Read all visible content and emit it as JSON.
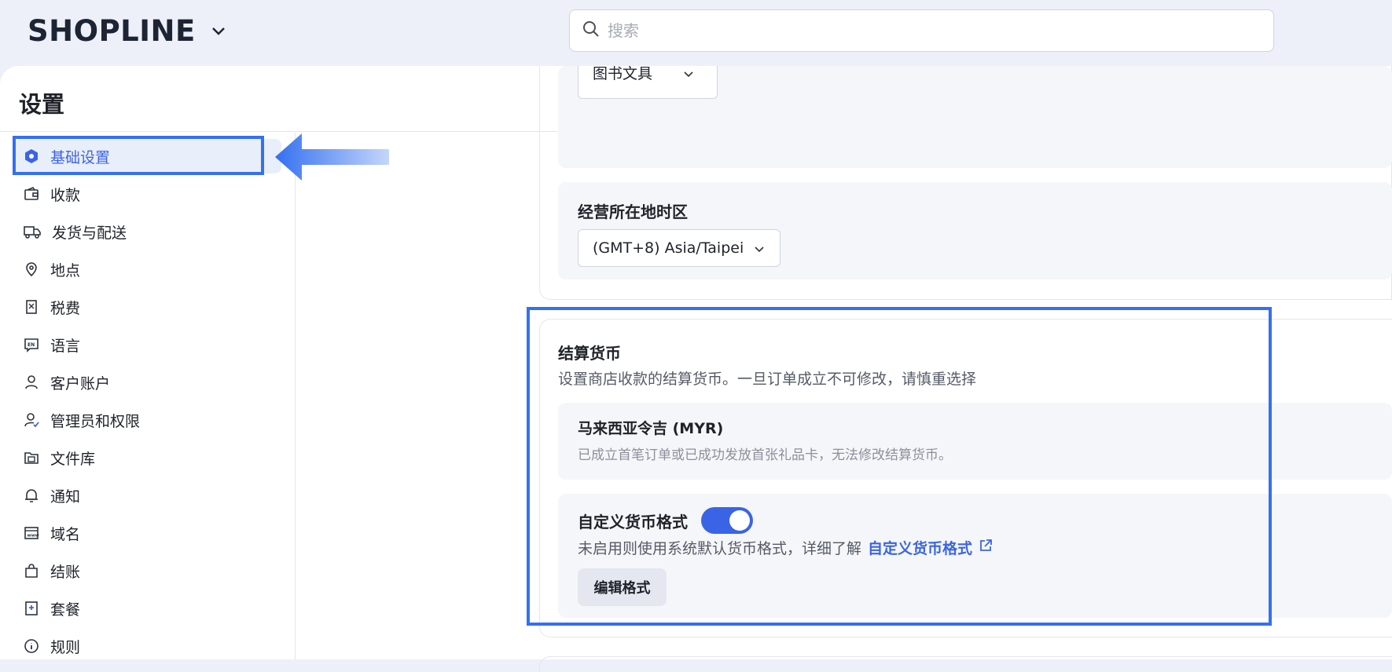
{
  "app": {
    "logo_text": "SHOPLINE"
  },
  "search": {
    "placeholder": "搜索"
  },
  "page": {
    "title": "设置"
  },
  "sidebar": {
    "items": [
      {
        "label": "基础设置",
        "icon": "hexagon-icon",
        "active": true
      },
      {
        "label": "收款",
        "icon": "wallet-icon"
      },
      {
        "label": "发货与配送",
        "icon": "truck-icon"
      },
      {
        "label": "地点",
        "icon": "location-pin-icon"
      },
      {
        "label": "税费",
        "icon": "receipt-icon"
      },
      {
        "label": "语言",
        "icon": "language-icon"
      },
      {
        "label": "客户账户",
        "icon": "user-icon"
      },
      {
        "label": "管理员和权限",
        "icon": "admin-icon"
      },
      {
        "label": "文件库",
        "icon": "folder-icon"
      },
      {
        "label": "通知",
        "icon": "bell-icon"
      },
      {
        "label": "域名",
        "icon": "domain-icon"
      },
      {
        "label": "结账",
        "icon": "shopping-bag-icon"
      },
      {
        "label": "套餐",
        "icon": "plan-icon"
      },
      {
        "label": "规则",
        "icon": "info-icon"
      }
    ]
  },
  "store": {
    "category_select": "图书文具",
    "timezone_label": "经营所在地时区",
    "timezone_value": "(GMT+8) Asia/Taipei"
  },
  "currency": {
    "title": "结算货币",
    "description": "设置商店收款的结算货币。一旦订单成立不可修改，请慎重选择",
    "selected_name": "马来西亚令吉 (MYR)",
    "selected_note": "已成立首笔订单或已成功发放首张礼品卡，无法修改结算货币。",
    "format_title": "自定义货币格式",
    "format_enabled": true,
    "format_desc": "未启用则使用系统默认货币格式，详细了解",
    "format_link": "自定义货币格式",
    "edit_button": "编辑格式"
  },
  "colors": {
    "accent": "#3a64e6",
    "highlight": "#3470f0"
  }
}
